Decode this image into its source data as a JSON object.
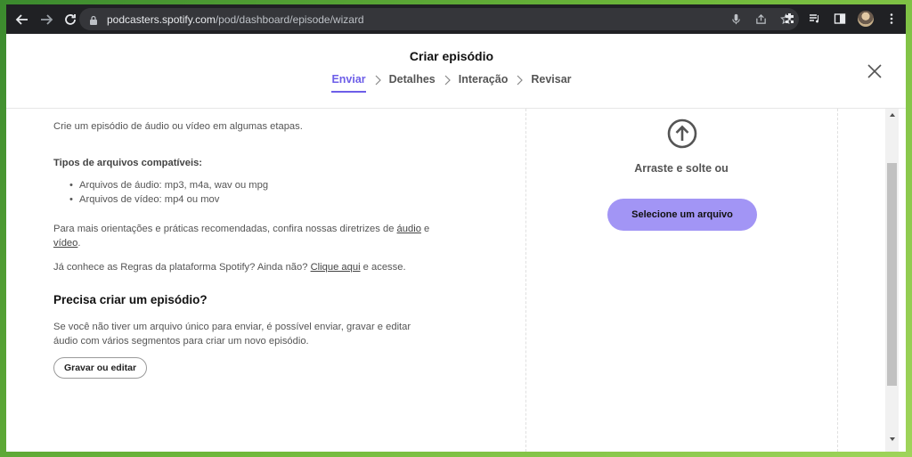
{
  "browser": {
    "url_host": "podcasters.spotify.com",
    "url_path": "/pod/dashboard/episode/wizard"
  },
  "header": {
    "title": "Criar episódio",
    "steps": [
      "Enviar",
      "Detalhes",
      "Interação",
      "Revisar"
    ],
    "active_step": "Enviar"
  },
  "left": {
    "intro": "Crie um episódio de áudio ou vídeo em algumas etapas.",
    "types_heading": "Tipos de arquivos compatíveis:",
    "types": [
      "Arquivos de áudio: mp3, m4a, wav ou mpg",
      "Arquivos de vídeo: mp4 ou mov"
    ],
    "guide_text": "Para mais orientações e práticas recomendadas, confira nossas diretrizes de",
    "guide_link_audio": "áudio",
    "guide_and": "e",
    "guide_link_video": "vídeo",
    "guide_end": ".",
    "rules_text": "Já conhece as Regras da plataforma Spotify? Ainda não?",
    "rules_link": "Clique aqui",
    "rules_end": "e acesse.",
    "need_title": "Precisa criar um episódio?",
    "need_text": "Se você não tiver um arquivo único para enviar, é possível enviar, gravar e editar áudio com vários segmentos para criar um novo episódio.",
    "record_button": "Gravar ou editar"
  },
  "upload": {
    "drag_label": "Arraste e solte ou",
    "select_button": "Selecione um arquivo"
  },
  "colors": {
    "accent": "#6d5ee8",
    "select_button_bg": "#a295f5",
    "chrome_bg": "#202124"
  }
}
